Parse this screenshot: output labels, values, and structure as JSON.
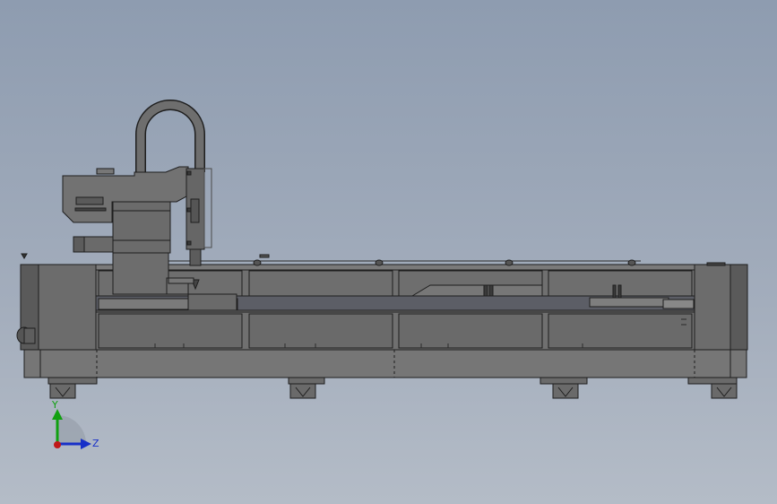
{
  "triad": {
    "y_label": "Y",
    "z_label": "Z",
    "y_color": "#10a010",
    "z_color": "#1830c8",
    "origin_color": "#c01818"
  },
  "colors": {
    "background_top": "#8e9cb0",
    "background_bottom": "#b4bcc7",
    "machine_fill": "#6f6f6f",
    "machine_dark": "#4e4e4e",
    "machine_light": "#7c7c7c",
    "edge": "#1e1e1e"
  }
}
